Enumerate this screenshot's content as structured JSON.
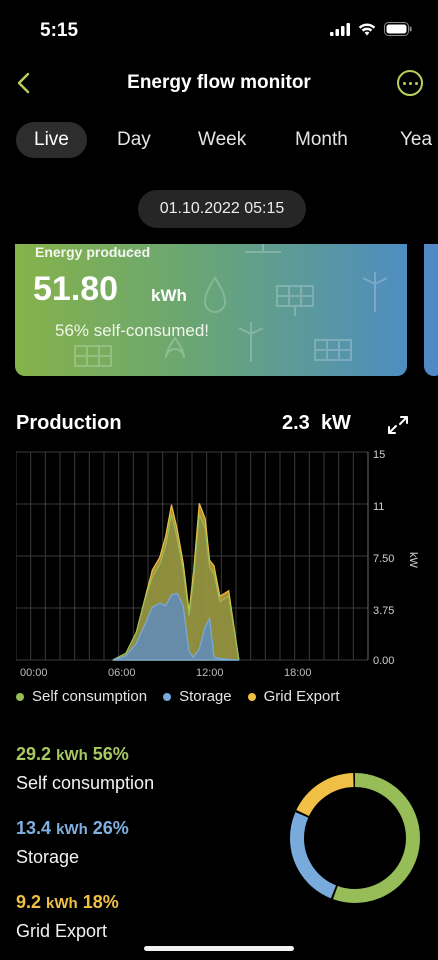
{
  "status_bar": {
    "time": "5:15"
  },
  "nav": {
    "title": "Energy flow monitor"
  },
  "tabs": [
    {
      "label": "Live",
      "active": true
    },
    {
      "label": "Day"
    },
    {
      "label": "Week"
    },
    {
      "label": "Month"
    },
    {
      "label": "Yea"
    }
  ],
  "date": "01.10.2022 05:15",
  "card": {
    "label": "Energy produced",
    "value": "51.80",
    "unit": "kWh",
    "subtitle": "56% self-consumed!"
  },
  "production": {
    "title": "Production",
    "value": "2.3",
    "unit": "kW"
  },
  "colors": {
    "self_consumption": "#96bd58",
    "storage": "#78aadb",
    "grid_export": "#f0c046",
    "accent": "#b6d15a"
  },
  "legend": [
    {
      "label": "Self consumption",
      "color": "#96bd58"
    },
    {
      "label": "Storage",
      "color": "#78aadb"
    },
    {
      "label": "Grid Export",
      "color": "#f0c046"
    }
  ],
  "stats": [
    {
      "value": "29.2",
      "unit": "kWh",
      "percent": "56%",
      "name": "Self consumption",
      "color": "#a8c862"
    },
    {
      "value": "13.4",
      "unit": "kWh",
      "percent": "26%",
      "name": "Storage",
      "color": "#7fb0e0"
    },
    {
      "value": "9.2",
      "unit": "kWh",
      "percent": "18%",
      "name": "Grid Export",
      "color": "#f0c046"
    }
  ],
  "chart_data": {
    "type": "area",
    "x_tick_labels": [
      "00:00",
      "06:00",
      "12:00",
      "18:00"
    ],
    "y_tick_labels": [
      "15",
      "11",
      "7.50",
      "3.75",
      "0.00"
    ],
    "ylabel": "kW",
    "ylim": [
      0,
      15
    ],
    "xlim_hours": [
      0,
      24
    ],
    "grid": true,
    "legend_position": "bottom",
    "series": [
      {
        "name": "Storage",
        "points": [
          [
            6.6,
            0
          ],
          [
            7.5,
            0.3
          ],
          [
            8.2,
            1.2
          ],
          [
            8.8,
            2.6
          ],
          [
            9.3,
            3.8
          ],
          [
            9.8,
            4.1
          ],
          [
            10.2,
            3.9
          ],
          [
            10.6,
            4.7
          ],
          [
            11.0,
            4.8
          ],
          [
            11.4,
            3.9
          ],
          [
            11.8,
            0.6
          ],
          [
            12.1,
            0.2
          ],
          [
            12.5,
            0.8
          ],
          [
            12.9,
            2.4
          ],
          [
            13.2,
            3.0
          ],
          [
            13.5,
            0.2
          ],
          [
            13.9,
            0.1
          ],
          [
            14.5,
            0.05
          ],
          [
            15.2,
            0
          ]
        ]
      },
      {
        "name": "Grid Export",
        "points": [
          [
            6.6,
            0
          ],
          [
            7.5,
            0.5
          ],
          [
            8.2,
            2.0
          ],
          [
            8.8,
            4.5
          ],
          [
            9.3,
            6.5
          ],
          [
            9.8,
            7.4
          ],
          [
            10.2,
            8.9
          ],
          [
            10.6,
            11.2
          ],
          [
            11.0,
            9.4
          ],
          [
            11.4,
            7.0
          ],
          [
            11.8,
            3.5
          ],
          [
            12.1,
            6.3
          ],
          [
            12.5,
            11.3
          ],
          [
            12.9,
            10.2
          ],
          [
            13.2,
            7.2
          ],
          [
            13.5,
            6.8
          ],
          [
            13.9,
            4.6
          ],
          [
            14.5,
            5.0
          ],
          [
            15.2,
            0
          ]
        ]
      },
      {
        "name": "Self consumption",
        "points": [
          [
            6.6,
            0
          ],
          [
            7.5,
            0.5
          ],
          [
            8.2,
            2.0
          ],
          [
            8.8,
            4.4
          ],
          [
            9.3,
            6.0
          ],
          [
            9.8,
            6.9
          ],
          [
            10.2,
            8.2
          ],
          [
            10.6,
            10.5
          ],
          [
            11.0,
            8.7
          ],
          [
            11.4,
            6.5
          ],
          [
            11.8,
            3.2
          ],
          [
            12.1,
            5.8
          ],
          [
            12.5,
            10.5
          ],
          [
            12.9,
            9.5
          ],
          [
            13.2,
            6.7
          ],
          [
            13.5,
            6.2
          ],
          [
            13.9,
            4.2
          ],
          [
            14.5,
            4.6
          ],
          [
            15.2,
            0
          ]
        ]
      }
    ]
  },
  "donut_data": [
    {
      "name": "Self consumption",
      "percent": 56,
      "color": "#96bd58"
    },
    {
      "name": "Storage",
      "percent": 26,
      "color": "#78aadb"
    },
    {
      "name": "Grid Export",
      "percent": 18,
      "color": "#f0c046"
    }
  ]
}
